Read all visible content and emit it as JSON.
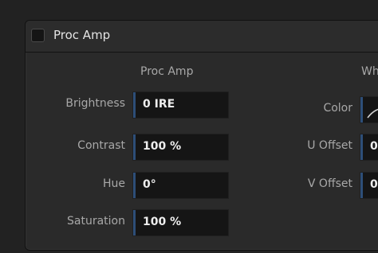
{
  "panel": {
    "title": "Proc Amp",
    "enabled": false
  },
  "proc_amp": {
    "title": "Proc Amp",
    "fields": [
      {
        "label": "Brightness",
        "value": "0 IRE"
      },
      {
        "label": "Contrast",
        "value": "100 %"
      },
      {
        "label": "Hue",
        "value": "0°"
      },
      {
        "label": "Saturation",
        "value": "100 %"
      }
    ]
  },
  "white_balance": {
    "title": "Wh",
    "fields": [
      {
        "label": "Color",
        "value": "",
        "icon": "color-curve-icon"
      },
      {
        "label": "U Offset",
        "value": "0"
      },
      {
        "label": "V Offset",
        "value": "0"
      }
    ]
  },
  "colors": {
    "accent": "#2d4e78",
    "field_bg": "#151515",
    "panel_bg": "#2a2a2a"
  }
}
